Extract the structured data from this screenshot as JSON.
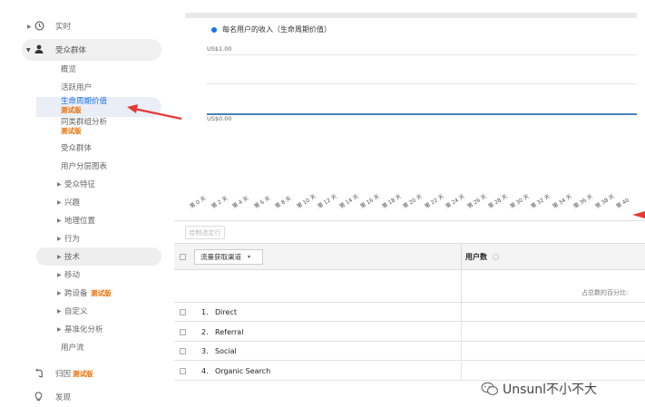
{
  "sidebar": {
    "realtime": "实时",
    "audience": "受众群体",
    "items": {
      "overview": "概览",
      "active_users": "活跃用户",
      "ltv": "生命周期价值",
      "ltv_beta": "测试版",
      "cohort": "同类群组分析",
      "cohort_beta": "测试版",
      "audiences": "受众群体",
      "user_explorer": "用户分层图表",
      "demographics": "受众特征",
      "interests": "兴趣",
      "geo": "地理位置",
      "behavior": "行为",
      "technology": "技术",
      "mobile": "移动",
      "cross_device": "跨设备",
      "cross_device_beta": "测试版",
      "custom": "自定义",
      "benchmarking": "基准化分析",
      "users_flow": "用户流"
    },
    "attribution": "归因",
    "attribution_beta": "测试版",
    "discover": "发现"
  },
  "chart": {
    "legend": "每名用户的收入（生命周期价值）",
    "ytop": "US$1.00",
    "ybottom": "US$0.00",
    "xticks": [
      "第 0 天",
      "第 2 天",
      "第 4 天",
      "第 6 天",
      "第 8 天",
      "第 10 天",
      "第 12 天",
      "第 14 天",
      "第 16 天",
      "第 18 天",
      "第 20 天",
      "第 22 天",
      "第 24 天",
      "第 26 天",
      "第 28 天",
      "第 30 天",
      "第 32 天",
      "第 34 天",
      "第 36 天",
      "第 38 天",
      "第 40"
    ]
  },
  "chart_data": {
    "type": "line",
    "title": "",
    "series": [
      {
        "name": "每名用户的收入（生命周期价值）",
        "values": [
          0,
          0,
          0,
          0,
          0,
          0,
          0,
          0,
          0,
          0,
          0,
          0,
          0,
          0,
          0,
          0,
          0,
          0,
          0,
          0,
          0
        ]
      }
    ],
    "ylim": [
      0,
      1
    ],
    "yticks": [
      "US$0.00",
      "US$1.00"
    ]
  },
  "table": {
    "plot_rows_btn": "绘制选定行",
    "dimension": "流量获取渠道",
    "users_col": "用户数",
    "total_label": "占总数的百分比:",
    "rows": [
      {
        "num": "1.",
        "name": "Direct"
      },
      {
        "num": "2.",
        "name": "Referral"
      },
      {
        "num": "3.",
        "name": "Social"
      },
      {
        "num": "4.",
        "name": "Organic Search"
      }
    ]
  },
  "watermark": "Unsunl不小不大",
  "colors": {
    "accent": "#1a73e8",
    "beta": "#e8710a",
    "arrow": "#e53935"
  }
}
